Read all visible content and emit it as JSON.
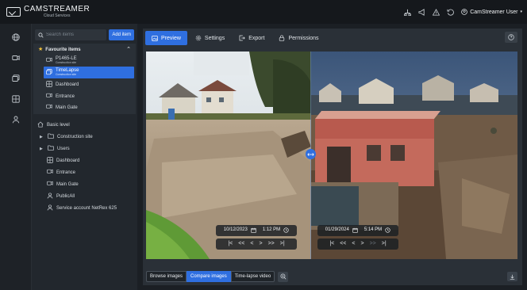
{
  "app": {
    "logo_title": "CAMSTREAMER",
    "logo_sub": "Cloud Services"
  },
  "topbar": {
    "icons": [
      "network-icon",
      "megaphone-icon",
      "alert-icon",
      "history-icon"
    ],
    "user_label": "CamStreamer User"
  },
  "rail": {
    "icons": [
      "globe-icon",
      "camera-icon",
      "gallery-icon",
      "dashboard-icon",
      "users-icon"
    ]
  },
  "sidebar": {
    "search_placeholder": "Search items",
    "add_item": "Add item",
    "favourites": {
      "title": "Favourite items",
      "items": [
        {
          "label": "P1465-LE",
          "sub": "Construction site",
          "icon": "camera-icon"
        },
        {
          "label": "TimeLapse",
          "sub": "Construction site",
          "icon": "gallery-icon",
          "active": true
        },
        {
          "label": "Dashboard",
          "icon": "dashboard-icon"
        },
        {
          "label": "Entrance",
          "icon": "camera-icon"
        },
        {
          "label": "Main Gate",
          "icon": "camera-icon"
        }
      ]
    },
    "tree": {
      "root": "Basic level",
      "folders": [
        "Construction site",
        "Users"
      ],
      "items": [
        "Dashboard",
        "Entrance",
        "Main Gate",
        "PublicAll",
        "Service account NetRex 625"
      ]
    }
  },
  "tabs": [
    {
      "label": "Preview",
      "icon": "image-icon",
      "active": true
    },
    {
      "label": "Settings",
      "icon": "gear-icon"
    },
    {
      "label": "Export",
      "icon": "export-icon"
    },
    {
      "label": "Permissions",
      "icon": "lock-icon"
    }
  ],
  "compare": {
    "left": {
      "date": "10/12/2023",
      "time": "1:12 PM"
    },
    "right": {
      "date": "01/29/2024",
      "time": "5:14 PM"
    },
    "nav": [
      "|<",
      "<<",
      "<",
      ">",
      ">>",
      ">|"
    ]
  },
  "modes": {
    "browse": "Browse images",
    "compare": "Compare images",
    "timelapse": "Time-lapse video"
  }
}
